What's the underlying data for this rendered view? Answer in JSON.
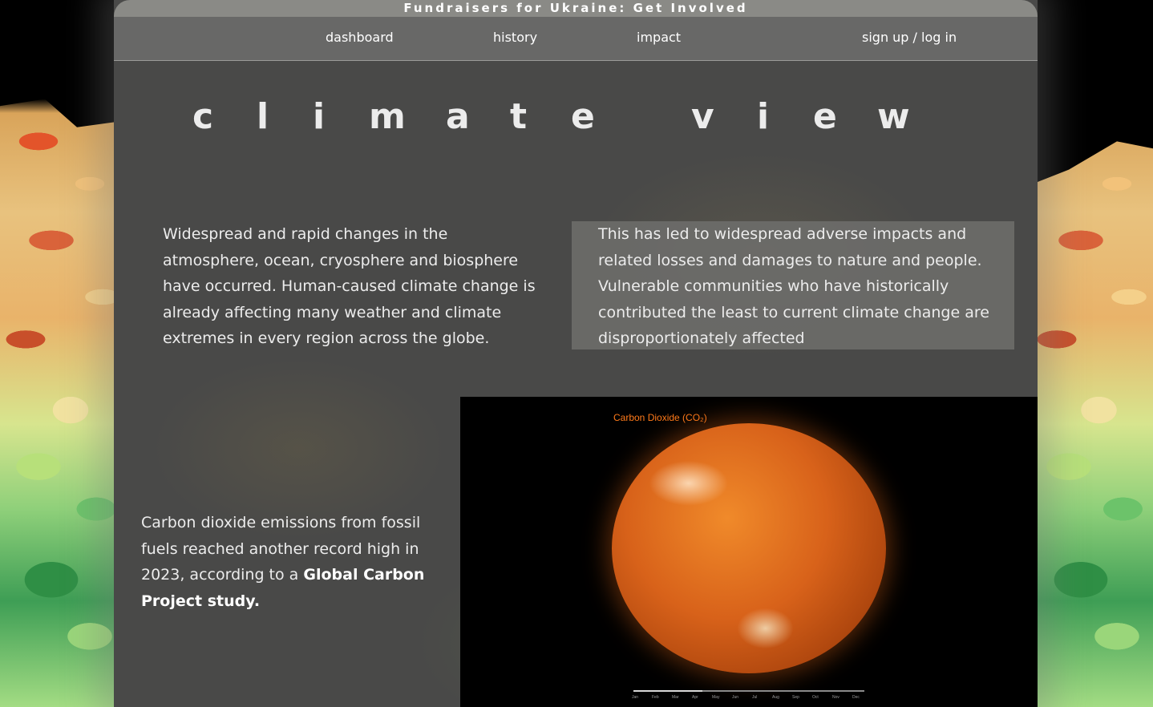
{
  "banner": {
    "link_text": "Fundraisers for Ukraine: Get Involved"
  },
  "nav": {
    "items": [
      "dashboard",
      "history",
      "impact"
    ],
    "auth": "sign up / log in"
  },
  "title": {
    "text": "climate view",
    "letters": [
      "c",
      "l",
      "i",
      "m",
      "a",
      "t",
      "e",
      "v",
      "i",
      "e",
      "w"
    ]
  },
  "content": {
    "left_paragraph": "Widespread and rapid changes in the atmosphere, ocean, cryosphere and biosphere have occurred. Human-caused climate change is already affecting many weather and climate extremes in every region across the globe.",
    "right_paragraph": "This has led to widespread adverse impacts and related losses and damages to nature and people. Vulnerable communities who have historically contributed the least to current climate change are disproportionately affected",
    "bottom_paragraph_prefix": "Carbon dioxide emissions from fossil fuels reached another record high in 2023, according to a ",
    "bottom_paragraph_link": "Global Carbon Project study."
  },
  "video": {
    "caption": "Carbon Dioxide (CO₂)",
    "months": [
      "Jan",
      "Feb",
      "Mar",
      "Apr",
      "May",
      "Jun",
      "Jul",
      "Aug",
      "Sep",
      "Oct",
      "Nov",
      "Dec"
    ],
    "progress_fraction": 0.3
  },
  "colors": {
    "panel": "#4a4a49",
    "navbar": "#686867",
    "topbar": "#8a8a86",
    "co2_accent": "#ff7a1a"
  }
}
